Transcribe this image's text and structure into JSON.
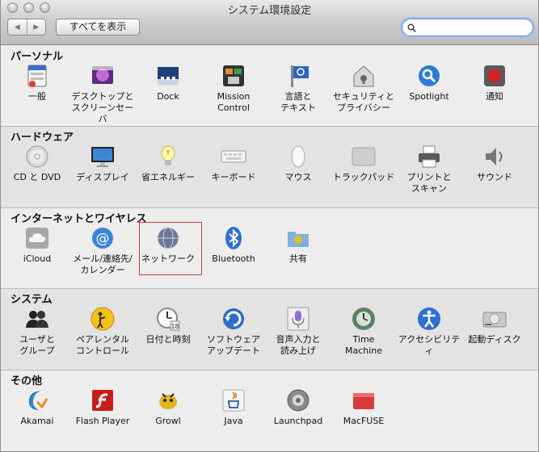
{
  "window": {
    "title": "システム環境設定"
  },
  "toolbar": {
    "back_glyph": "◀",
    "forward_glyph": "▶",
    "show_all_label": "すべてを表示",
    "search_value": "",
    "search_placeholder": ""
  },
  "sections": [
    {
      "title": "パーソナル",
      "items": [
        {
          "label": "一般",
          "icon": "general-icon"
        },
        {
          "label": "デスクトップと\nスクリーンセーバ",
          "icon": "desktop-icon"
        },
        {
          "label": "Dock",
          "icon": "dock-icon"
        },
        {
          "label": "Mission\nControl",
          "icon": "mission-control-icon"
        },
        {
          "label": "言語と\nテキスト",
          "icon": "language-icon"
        },
        {
          "label": "セキュリティと\nプライバシー",
          "icon": "security-icon"
        },
        {
          "label": "Spotlight",
          "icon": "spotlight-icon"
        },
        {
          "label": "通知",
          "icon": "notifications-icon"
        }
      ]
    },
    {
      "title": "ハードウェア",
      "items": [
        {
          "label": "CD と DVD",
          "icon": "cd-dvd-icon"
        },
        {
          "label": "ディスプレイ",
          "icon": "display-icon"
        },
        {
          "label": "省エネルギー",
          "icon": "energy-saver-icon"
        },
        {
          "label": "キーボード",
          "icon": "keyboard-icon"
        },
        {
          "label": "マウス",
          "icon": "mouse-icon"
        },
        {
          "label": "トラックパッド",
          "icon": "trackpad-icon"
        },
        {
          "label": "プリントと\nスキャン",
          "icon": "printer-icon"
        },
        {
          "label": "サウンド",
          "icon": "sound-icon"
        }
      ]
    },
    {
      "title": "インターネットとワイヤレス",
      "items": [
        {
          "label": "iCloud",
          "icon": "icloud-icon"
        },
        {
          "label": "メール/連絡先/\nカレンダー",
          "icon": "mail-icon"
        },
        {
          "label": "ネットワーク",
          "icon": "network-icon"
        },
        {
          "label": "Bluetooth",
          "icon": "bluetooth-icon"
        },
        {
          "label": "共有",
          "icon": "sharing-icon"
        }
      ]
    },
    {
      "title": "システム",
      "items": [
        {
          "label": "ユーザと\nグループ",
          "icon": "users-icon"
        },
        {
          "label": "ペアレンタル\nコントロール",
          "icon": "parental-controls-icon"
        },
        {
          "label": "日付と時刻",
          "icon": "date-time-icon"
        },
        {
          "label": "ソフトウェア\nアップデート",
          "icon": "software-update-icon"
        },
        {
          "label": "音声入力と\n読み上げ",
          "icon": "dictation-icon"
        },
        {
          "label": "Time\nMachine",
          "icon": "time-machine-icon"
        },
        {
          "label": "アクセシビリティ",
          "icon": "accessibility-icon"
        },
        {
          "label": "起動ディスク",
          "icon": "startup-disk-icon"
        }
      ]
    },
    {
      "title": "その他",
      "items": [
        {
          "label": "Akamai",
          "icon": "akamai-icon"
        },
        {
          "label": "Flash Player",
          "icon": "flash-player-icon"
        },
        {
          "label": "Growl",
          "icon": "growl-icon"
        },
        {
          "label": "Java",
          "icon": "java-icon"
        },
        {
          "label": "Launchpad",
          "icon": "launchpad-icon"
        },
        {
          "label": "MacFUSE",
          "icon": "macfuse-icon"
        }
      ]
    }
  ],
  "highlighted_item": "ネットワーク"
}
